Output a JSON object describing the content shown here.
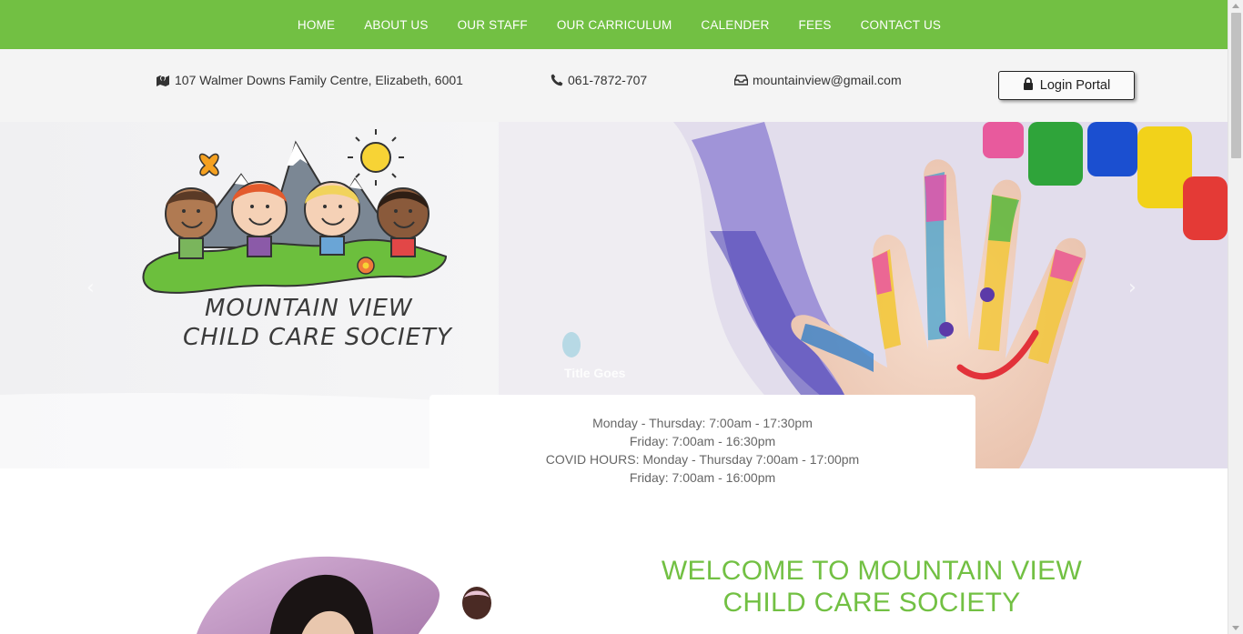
{
  "nav": {
    "items": [
      {
        "label": "HOME"
      },
      {
        "label": "ABOUT US"
      },
      {
        "label": "OUR STAFF"
      },
      {
        "label": "OUR CARRICULUM"
      },
      {
        "label": "CALENDER"
      },
      {
        "label": "FEES"
      },
      {
        "label": "CONTACT US"
      }
    ]
  },
  "contact": {
    "address": "107 Walmer Downs Family Centre, Elizabeth, 6001",
    "phone": "061-7872-707",
    "email": "mountainview@gmail.com",
    "login_label": "Login Portal",
    "address_icon": "map-marker-icon",
    "phone_icon": "phone-icon",
    "email_icon": "inbox-icon",
    "login_icon": "lock-icon"
  },
  "hero": {
    "logo_line1": "MOUNTAIN VIEW",
    "logo_line2": "CHILD CARE SOCIETY",
    "caption": "Title Goes",
    "prev_icon": "chevron-left-icon",
    "next_icon": "chevron-right-icon"
  },
  "hours": {
    "lines": [
      "Monday - Thursday: 7:00am - 17:30pm",
      "Friday: 7:00am - 16:30pm",
      "COVID HOURS: Monday - Thursday 7:00am - 17:00pm",
      "Friday: 7:00am - 16:00pm"
    ]
  },
  "welcome": {
    "line1": "WELCOME TO MOUNTAIN VIEW",
    "line2": "CHILD CARE SOCIETY"
  },
  "colors": {
    "brand_green": "#72c043",
    "info_bar_bg": "#f4f4f4"
  }
}
